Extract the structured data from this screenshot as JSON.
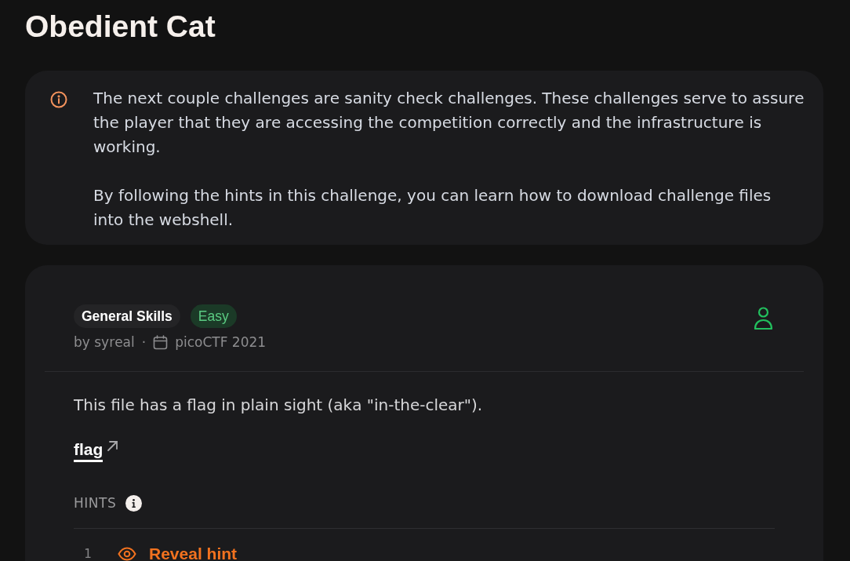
{
  "title": "Obedient Cat",
  "notice": {
    "paragraphs": [
      "The next couple challenges are sanity check challenges. These challenges serve to assure the player that they are accessing the competition correctly and the infrastructure is working.",
      "By following the hints in this challenge, you can learn how to download challenge files into the webshell."
    ]
  },
  "challenge": {
    "tags": [
      {
        "label": "General Skills",
        "kind": "category"
      },
      {
        "label": "Easy",
        "kind": "difficulty"
      }
    ],
    "author": "by syreal",
    "separator": "·",
    "event": "picoCTF 2021",
    "description": "This file has a flag in plain sight (aka \"in-the-clear\").",
    "link": "flag",
    "hints_heading": "HINTS",
    "hints": [
      {
        "number": "1",
        "action": "Reveal hint"
      }
    ]
  }
}
